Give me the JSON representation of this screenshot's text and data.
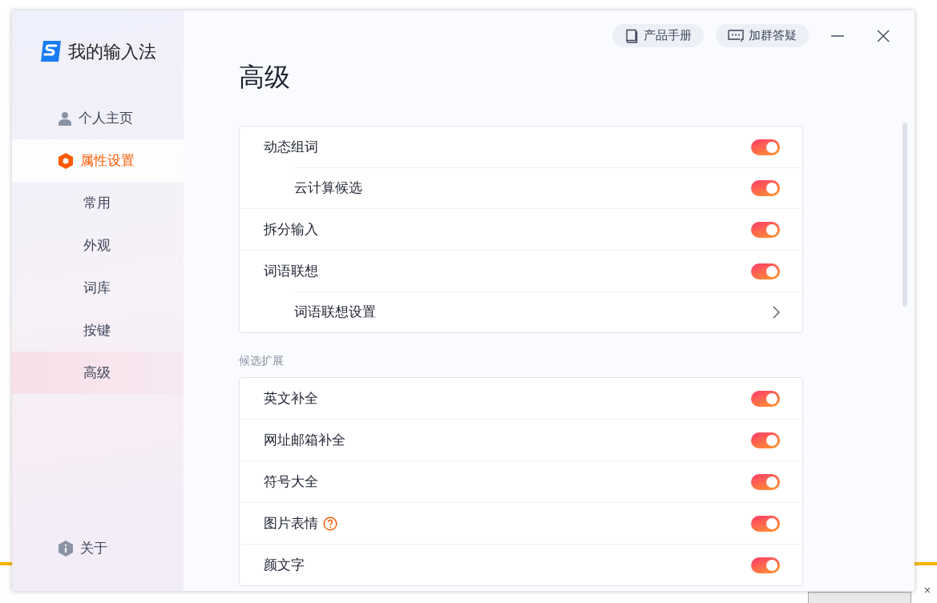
{
  "background": {
    "close_glyph": "×"
  },
  "window": {
    "app_name": "我的输入法",
    "header_buttons": [
      {
        "label": "产品手册",
        "kind": "book"
      },
      {
        "label": "加群答疑",
        "kind": "chat"
      }
    ]
  },
  "sidebar": {
    "items": [
      {
        "label": "个人主页",
        "kind": "user",
        "selected": false
      },
      {
        "label": "属性设置",
        "kind": "settings",
        "selected": true,
        "children": [
          {
            "label": "常用",
            "selected": false
          },
          {
            "label": "外观",
            "selected": false
          },
          {
            "label": "词库",
            "selected": false
          },
          {
            "label": "按键",
            "selected": false
          },
          {
            "label": "高级",
            "selected": true
          }
        ]
      }
    ],
    "footer": {
      "label": "关于",
      "kind": "info"
    }
  },
  "page": {
    "title": "高级",
    "sections": [
      {
        "rows": [
          {
            "label": "动态组词",
            "kind": "toggle",
            "on": true,
            "children": [
              {
                "label": "云计算候选",
                "kind": "toggle",
                "on": true
              }
            ]
          },
          {
            "label": "拆分输入",
            "kind": "toggle",
            "on": true
          },
          {
            "label": "词语联想",
            "kind": "toggle",
            "on": true,
            "children": [
              {
                "label": "词语联想设置",
                "kind": "link"
              }
            ]
          }
        ]
      },
      {
        "heading": "候选扩展",
        "rows": [
          {
            "label": "英文补全",
            "kind": "toggle",
            "on": true
          },
          {
            "label": "网址邮箱补全",
            "kind": "toggle",
            "on": true
          },
          {
            "label": "符号大全",
            "kind": "toggle",
            "on": true
          },
          {
            "label": "图片表情",
            "kind": "toggle",
            "on": true,
            "help": true
          },
          {
            "label": "颜文字",
            "kind": "toggle",
            "on": true
          }
        ]
      }
    ]
  }
}
